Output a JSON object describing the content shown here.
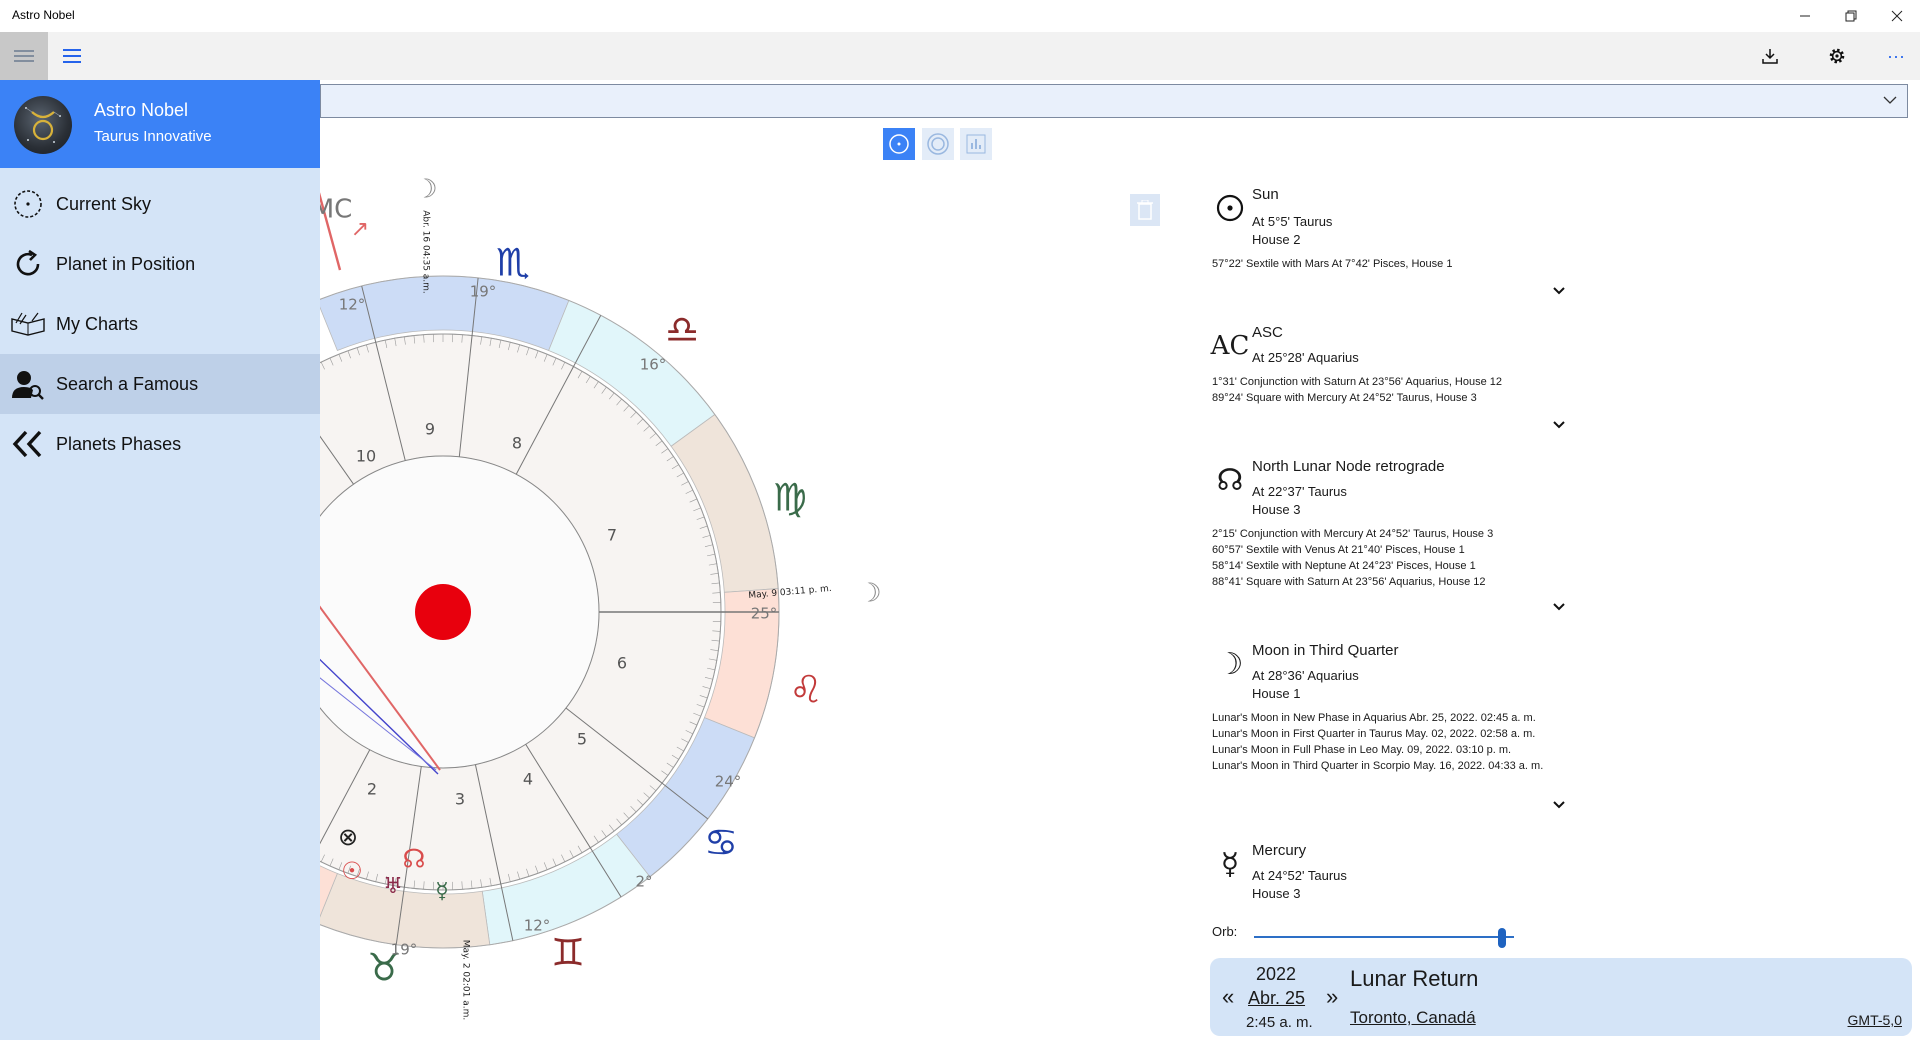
{
  "app": {
    "title": "Astro Nobel"
  },
  "window": {
    "minimize": "—",
    "restore": "❐",
    "close": "✕"
  },
  "toolbar": {
    "more": "···"
  },
  "profile": {
    "name": "Astro Nobel",
    "subtitle": "Taurus Innovative"
  },
  "sidebar": {
    "items": [
      {
        "label": "Current Sky",
        "icon": "current-sky-icon"
      },
      {
        "label": "Planet in Position",
        "icon": "refresh-icon"
      },
      {
        "label": "My Charts",
        "icon": "book-icon"
      },
      {
        "label": "Search a Famous",
        "icon": "person-search-icon",
        "active": true
      },
      {
        "label": "Planets Phases",
        "icon": "double-chevron-left-icon"
      }
    ]
  },
  "chart": {
    "labels": {
      "mc": "MC",
      "house_numbers": [
        "10",
        "9",
        "8",
        "7",
        "6",
        "5",
        "4",
        "3",
        "2"
      ],
      "degrees": [
        "12°",
        "19°",
        "16°",
        "25°",
        "24°",
        "2°",
        "12°",
        "19°"
      ],
      "time_note_1": "Abr. 16 04:35 a.m.",
      "time_note_2": "May. 9 03:11 p. m.",
      "time_note_3": "May. 2 02:01 a.m."
    },
    "signs": [
      "♏",
      "♎",
      "♍",
      "♌",
      "♋",
      "♊",
      "♉"
    ]
  },
  "planets": [
    {
      "symbol": "☉",
      "name": "Sun",
      "position": "At 5°5' Taurus",
      "house": "House 2",
      "aspects": [
        "57°22' Sextile with Mars At 7°42' Pisces, House 1"
      ]
    },
    {
      "symbol": "AC",
      "name": "ASC",
      "position": "At 25°28' Aquarius",
      "house": "",
      "aspects": [
        "1°31' Conjunction with Saturn At 23°56' Aquarius, House 12",
        "89°24' Square with Mercury At 24°52' Taurus, House 3"
      ]
    },
    {
      "symbol": "☊",
      "name": "North Lunar Node retrograde",
      "position": "At 22°37' Taurus",
      "house": "House 3",
      "aspects": [
        "2°15' Conjunction with Mercury At 24°52' Taurus, House 3",
        "60°57' Sextile with Venus At 21°40' Pisces, House 1",
        "58°14' Sextile with Neptune At 24°23' Pisces, House 1",
        "88°41' Square with Saturn At 23°56' Aquarius, House 12"
      ]
    },
    {
      "symbol": "☽",
      "name": "Moon in Third Quarter",
      "position": "At 28°36' Aquarius",
      "house": "House 1",
      "aspects": [
        "Lunar's Moon in New Phase in Aquarius Abr. 25, 2022. 02:45 a. m.",
        "Lunar's Moon in First Quarter in Taurus May. 02, 2022. 02:58 a. m.",
        "Lunar's Moon in Full Phase in Leo May. 09, 2022. 03:10 p. m.",
        "Lunar's Moon in Third Quarter in Scorpio May. 16, 2022. 04:33 a. m."
      ]
    },
    {
      "symbol": "☿",
      "name": "Mercury",
      "position": "At 24°52' Taurus",
      "house": "House 3",
      "aspects": []
    }
  ],
  "orb": {
    "label": "Orb:",
    "value_fraction": 0.97
  },
  "footer": {
    "year": "2022",
    "date": "Abr. 25",
    "time": "2:45 a. m.",
    "prev": "«",
    "next": "»",
    "title": "Lunar Return",
    "location": "Toronto, Canadá",
    "gmt": "GMT-5,0"
  },
  "colors": {
    "accent": "#3b82f6",
    "sidebar": "#d4e4f7",
    "toolbar": "#f2f2f2",
    "sun_dot": "#e8000d"
  }
}
